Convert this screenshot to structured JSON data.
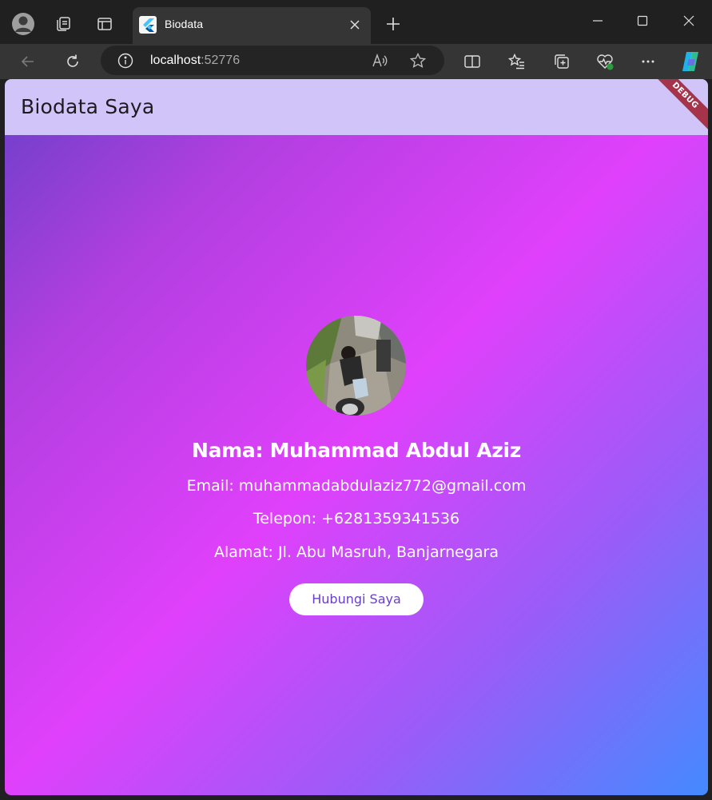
{
  "browser": {
    "tab_title": "Biodata",
    "url_host": "localhost",
    "url_port": ":52776"
  },
  "app": {
    "title": "Biodata Saya",
    "debug_label": "DEBUG"
  },
  "profile": {
    "name": "Nama: Muhammad Abdul Aziz",
    "email": "Email: muhammadabdulaziz772@gmail.com",
    "phone": "Telepon: +6281359341536",
    "address": "Alamat: Jl. Abu Masruh, Banjarnegara",
    "contact_button": "Hubungi Saya"
  },
  "colors": {
    "appbar": "#d1c4f9",
    "button_text": "#6a3fc8",
    "debug_banner": "#a5334a"
  }
}
